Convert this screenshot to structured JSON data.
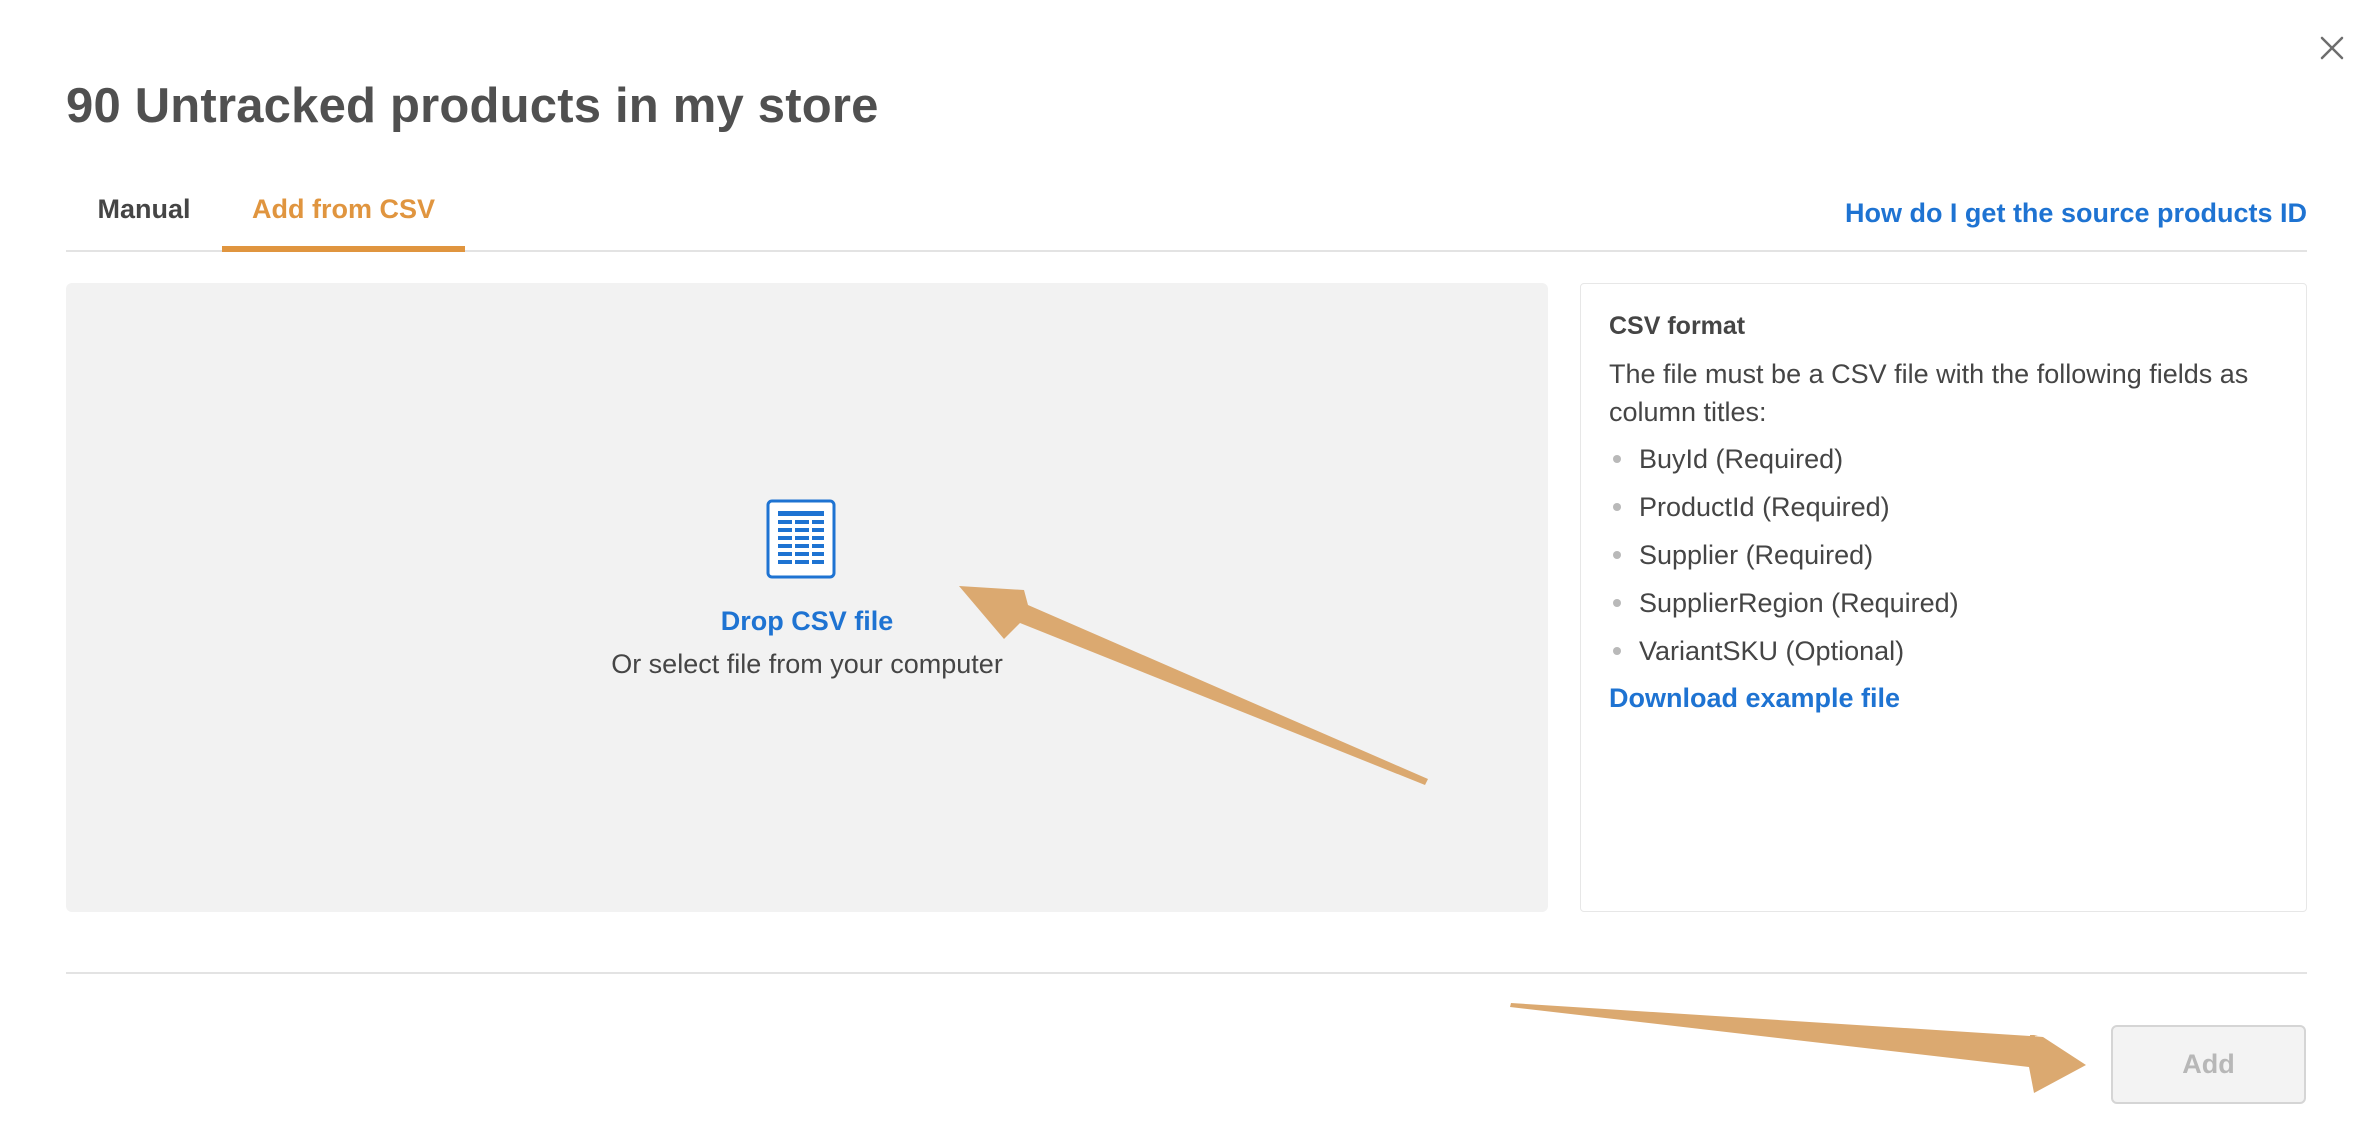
{
  "dialog": {
    "title": "90 Untracked products in my store",
    "close_icon": "close-icon"
  },
  "tabs": [
    {
      "label": "Manual",
      "active": false
    },
    {
      "label": "Add from CSV",
      "active": true
    }
  ],
  "help_link": "How do I get the source products ID",
  "dropzone": {
    "icon": "csv-file-icon",
    "title": "Drop CSV file",
    "subtitle": "Or select file from your computer"
  },
  "csv_format": {
    "title": "CSV format",
    "description": "The file must be a CSV file with the following fields as column titles:",
    "fields": [
      "BuyId (Required)",
      "ProductId (Required)",
      "Supplier (Required)",
      "SupplierRegion (Required)",
      "VariantSKU (Optional)"
    ],
    "download_link": "Download example file"
  },
  "footer": {
    "add_label": "Add",
    "add_disabled": true
  },
  "colors": {
    "accent_orange": "#e0953f",
    "link_blue": "#1e73d2",
    "annotation_arrow": "#dba970",
    "dropzone_bg": "#f2f2f2"
  }
}
